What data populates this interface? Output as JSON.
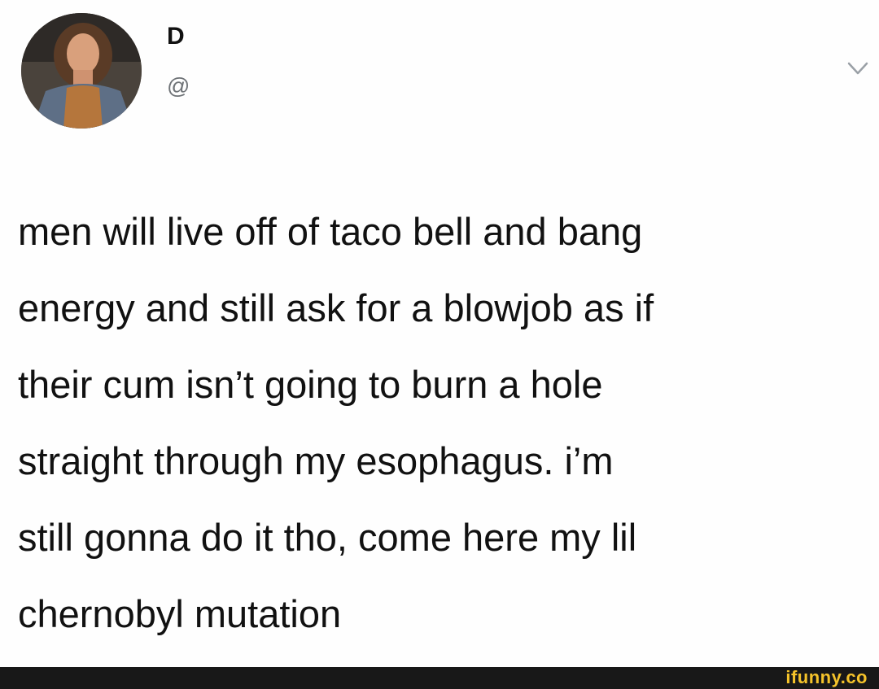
{
  "tweet": {
    "author": {
      "display_name": "D",
      "handle": "@"
    },
    "text": "men will live off of taco bell and bang\nenergy and still ask for a blowjob as if\ntheir cum isn’t going to burn a hole\nstraight through my esophagus. i’m\nstill gonna do it tho, come here my lil\nchernobyl mutation"
  },
  "icons": {
    "menu": "chevron-down-icon"
  },
  "watermark": {
    "text": "ifunny.co"
  },
  "colors": {
    "text": "#111111",
    "handle": "#6f7377",
    "footer": "#181818",
    "watermark": "#f5c32a"
  }
}
